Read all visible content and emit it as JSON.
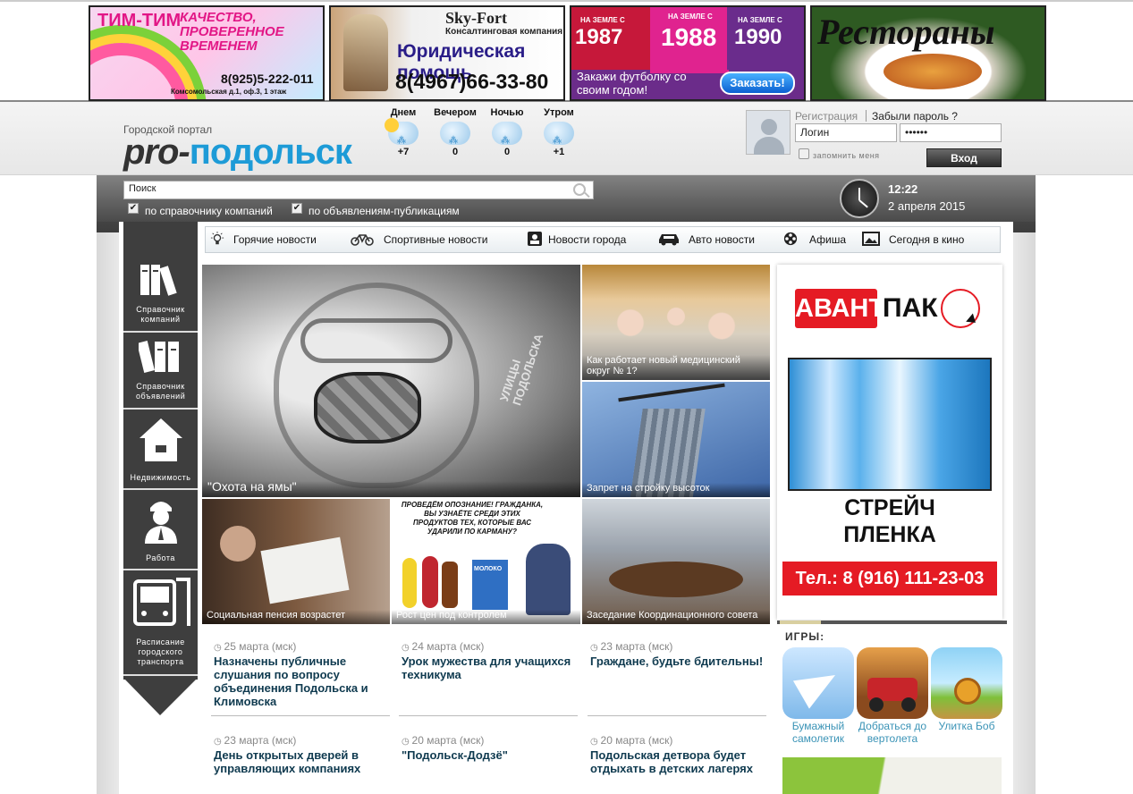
{
  "banners": {
    "timtim": {
      "title": "ТИМ-ТИМ",
      "slogan": "КАЧЕСТВО, ПРОВЕРЕННОЕ ВРЕМЕНЕМ",
      "phone": "8(925)5-222-011",
      "address": "Комсомольская д.1, оф.3, 1 этаж"
    },
    "skyfort": {
      "brand": "Sky-Fort",
      "sub": "Консалтинговая компания",
      "service": "Юридическая помощь",
      "phone": "8(4967)66-33-80"
    },
    "shirts": {
      "y1_label": "НА ЗЕМЛЕ С",
      "y1": "1987",
      "y2_label": "НА ЗЕМЛЕ С",
      "y2": "1988",
      "y3_label": "НА ЗЕМЛЕ С",
      "y3": "1990",
      "text": "Закажи футболку со своим годом!",
      "button": "Заказать!"
    },
    "restaurants": {
      "title": "Рестораны"
    }
  },
  "header": {
    "logo_small": "Городской портал",
    "logo_pro": "pro-",
    "logo_city": "подольск",
    "weather": [
      {
        "label": "Днем",
        "temp": "+7",
        "icon": "partly-cloudy-icon"
      },
      {
        "label": "Вечером",
        "temp": "0",
        "icon": "cloud-icon"
      },
      {
        "label": "Ночью",
        "temp": "0",
        "icon": "snow-cloud-icon"
      },
      {
        "label": "Утром",
        "temp": "+1",
        "icon": "snow-cloud-icon"
      }
    ],
    "auth": {
      "register": "Регистрация",
      "forgot": "Забыли пароль ?",
      "login_value": "Логин",
      "password_value": "••••••",
      "remember": "запомнить меня",
      "submit": "Вход"
    }
  },
  "search": {
    "placeholder": "Поиск",
    "opt1": "по справочнику компаний",
    "opt2": "по объявлениям-публикациям"
  },
  "clock": {
    "time": "12:22",
    "date": "2 апреля 2015"
  },
  "sidebar": [
    {
      "label": "Справочник компаний",
      "icon": "books-icon"
    },
    {
      "label": "Справочник объявлений",
      "icon": "folders-icon"
    },
    {
      "label": "Недвижимость",
      "icon": "house-icon"
    },
    {
      "label": "Работа",
      "icon": "worker-icon"
    },
    {
      "label": "Расписание городского транспорта",
      "icon": "bus-icon"
    }
  ],
  "categories": [
    {
      "label": "Горячие новости",
      "icon": "lightbulb-icon"
    },
    {
      "label": "Спортивные новости",
      "icon": "bicycle-icon"
    },
    {
      "label": "Новости города",
      "icon": "person-card-icon"
    },
    {
      "label": "Авто новости",
      "icon": "car-icon"
    },
    {
      "label": "Афиша",
      "icon": "film-reel-icon"
    },
    {
      "label": "Сегодня в кино",
      "icon": "picture-icon"
    }
  ],
  "tiles": [
    {
      "caption": "\"Охота на ямы\""
    },
    {
      "caption": "Как работает новый медицинский округ № 1?"
    },
    {
      "caption": "Запрет на стройку высоток"
    },
    {
      "caption": "Социальная пенсия возрастет"
    },
    {
      "caption": "Рост цен под контролем"
    },
    {
      "caption": "Заседание Координационного совета"
    }
  ],
  "tile_art": {
    "face": "УЛИЦЫ ПОДОЛЬСКА",
    "comic": "ПРОВЕДЁМ ОПОЗНАНИЕ! ГРАЖДАНКА, ВЫ УЗНАЁТЕ СРЕДИ ЭТИХ ПРОДУКТОВ ТЕХ, КОТОРЫЕ ВАС УДАРИЛИ ПО КАРМАНУ?",
    "comic_milk": "МОЛОКО"
  },
  "news": [
    {
      "date": "25 марта (мск)",
      "title": "Назначены публичные слушания по вопросу объединения Подольска и Климовска"
    },
    {
      "date": "24 марта (мск)",
      "title": "Урок мужества для учащихся техникума"
    },
    {
      "date": "23 марта (мск)",
      "title": "Граждане, будьте бдительны!"
    },
    {
      "date": "23 марта (мск)",
      "title": "День открытых дверей в управляющих компаниях"
    },
    {
      "date": "20 марта (мск)",
      "title": "\"Подольск-Додзё\""
    },
    {
      "date": "20 марта (мск)",
      "title": "Подольская детвора будет отдыхать в детских лагерях"
    }
  ],
  "ad": {
    "brand1": "АВАНТ",
    "brand2": "ПАК",
    "product": "СТРЕЙЧ ПЛЕНКА",
    "phone": "Тел.: 8 (916) 111-23-03"
  },
  "games": {
    "title": "ИГРЫ:",
    "items": [
      {
        "label": "Бумажный самолетик",
        "icon": "paper-plane-icon"
      },
      {
        "label": "Добраться до вертолета",
        "icon": "jeep-icon"
      },
      {
        "label": "Улитка Боб",
        "icon": "snail-icon"
      }
    ]
  },
  "colors": {
    "accent": "#1d9bd7",
    "news_title": "#0f3a4f",
    "ad_red": "#e51b24",
    "game_link": "#3a93b6"
  }
}
